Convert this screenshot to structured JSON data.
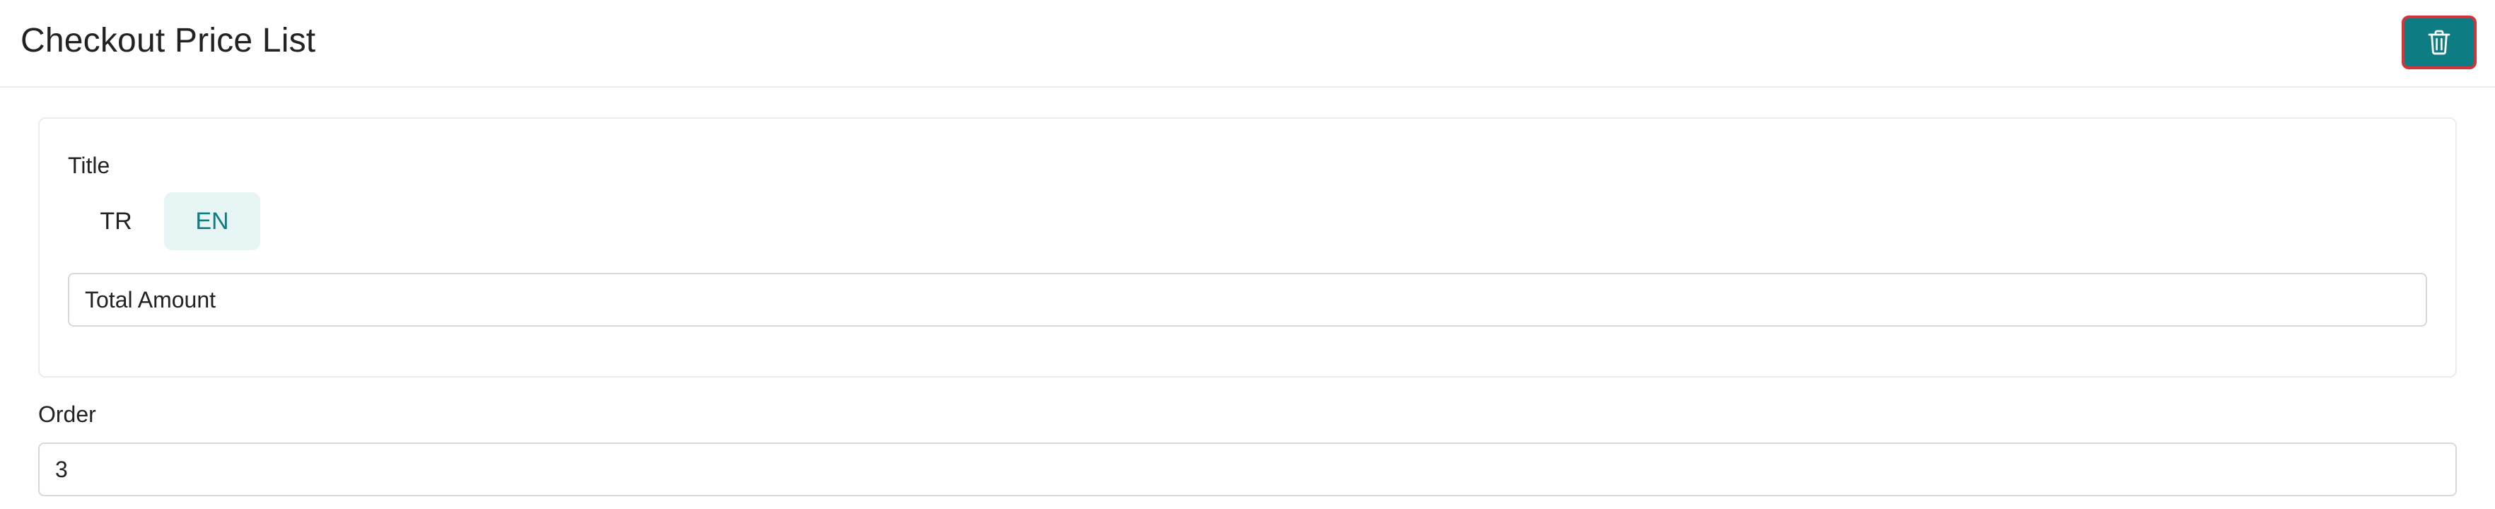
{
  "header": {
    "title": "Checkout Price List",
    "delete_icon": "trash-icon",
    "accent_color": "#0e7d83",
    "delete_border_color": "#d3343a"
  },
  "title_field": {
    "label": "Title",
    "languages": [
      {
        "code": "TR",
        "active": false
      },
      {
        "code": "EN",
        "active": true
      }
    ],
    "value": "Total Amount"
  },
  "order_field": {
    "label": "Order",
    "value": "3"
  }
}
